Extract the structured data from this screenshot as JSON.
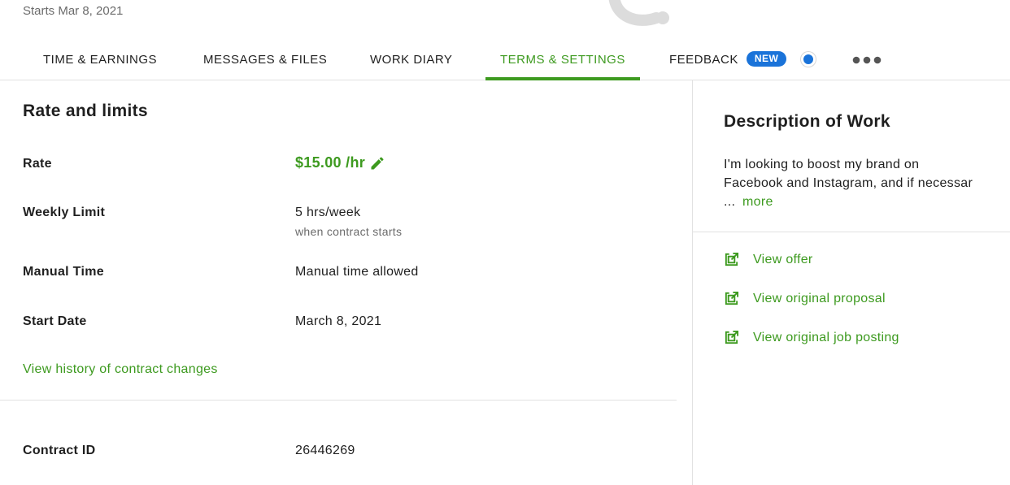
{
  "header": {
    "starts_text": "Starts Mar 8, 2021"
  },
  "tabs": [
    {
      "label": "TIME & EARNINGS"
    },
    {
      "label": "MESSAGES & FILES"
    },
    {
      "label": "WORK DIARY"
    },
    {
      "label": "TERMS & SETTINGS",
      "active": true
    },
    {
      "label": "FEEDBACK",
      "badge": "NEW"
    }
  ],
  "rate_section": {
    "title": "Rate and limits",
    "rate_label": "Rate",
    "rate_value": "$15.00 /hr",
    "weekly_label": "Weekly Limit",
    "weekly_value": "5 hrs/week",
    "weekly_sub": "when contract starts",
    "manual_label": "Manual Time",
    "manual_value": "Manual time allowed",
    "start_label": "Start Date",
    "start_value": "March 8, 2021",
    "history_link": "View history of contract changes"
  },
  "contract": {
    "id_label": "Contract ID",
    "id_value": "26446269"
  },
  "description": {
    "title": "Description of Work",
    "text": "I'm looking to boost my brand on Facebook and Instagram, and if necessar ...",
    "more_link": "more"
  },
  "side_links": [
    {
      "label": "View offer"
    },
    {
      "label": "View original proposal"
    },
    {
      "label": "View original job posting"
    }
  ],
  "colors": {
    "accent_green": "#3d9a1f",
    "badge_blue": "#1a73d9",
    "divider": "#e2e2e2",
    "muted_text": "#6b6b6b"
  },
  "icons": {
    "edit": "pencil-icon",
    "external": "external-link-icon",
    "more": "more-horizontal-icon"
  }
}
